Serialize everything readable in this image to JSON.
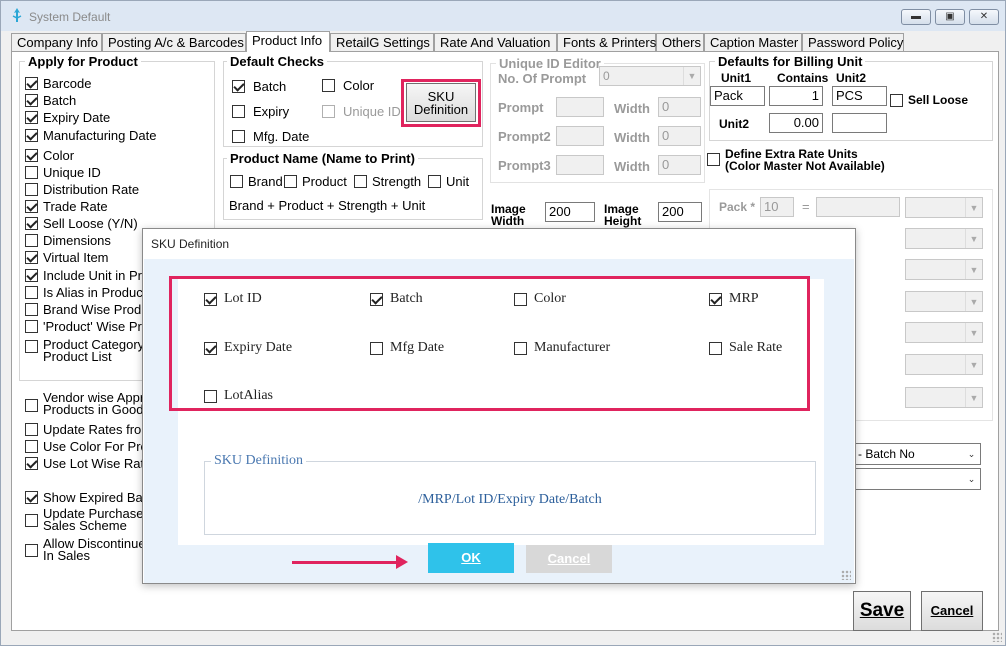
{
  "window": {
    "title": "System Default",
    "controls": {
      "minimize": "▬",
      "maximize": "▣",
      "close": "✕"
    }
  },
  "tabs": [
    "Company Info",
    "Posting A/c & Barcodes",
    "Product Info",
    "RetailG Settings",
    "Rate And Valuation",
    "Fonts & Printers",
    "Others",
    "Caption Master",
    "Password Policy"
  ],
  "apply_for_product": {
    "title": "Apply for Product",
    "items": [
      {
        "label": "Barcode",
        "checked": true
      },
      {
        "label": "Batch",
        "checked": true
      },
      {
        "label": "Expiry Date",
        "checked": true
      },
      {
        "label": "Manufacturing Date",
        "checked": true
      },
      {
        "label": "Color",
        "checked": true
      },
      {
        "label": "Unique ID",
        "checked": false
      },
      {
        "label": "Distribution Rate",
        "checked": false
      },
      {
        "label": "Trade Rate",
        "checked": true
      },
      {
        "label": "Sell Loose (Y/N)",
        "checked": true
      },
      {
        "label": "Dimensions",
        "checked": false
      },
      {
        "label": "Virtual Item",
        "checked": true
      },
      {
        "label": "Include Unit in Pr",
        "checked": true
      },
      {
        "label": "Is Alias in Product",
        "checked": false
      },
      {
        "label": "Brand Wise Produ",
        "checked": false
      },
      {
        "label": "'Product' Wise Pr",
        "checked": false
      },
      {
        "label": "Product Category\nProduct List",
        "checked": false
      }
    ]
  },
  "left_options": [
    {
      "label": "Vendor wise Appr\nProducts in Goods",
      "checked": false
    },
    {
      "label": "Update Rates from",
      "checked": false
    },
    {
      "label": "Use Color For Pro",
      "checked": false
    },
    {
      "label": "Use Lot Wise Rate",
      "checked": true
    },
    {
      "label": "Show Expired Bat",
      "checked": true
    },
    {
      "label": "Update Purchase\nSales Scheme",
      "checked": false
    },
    {
      "label": "Allow Discontinue\nIn Sales",
      "checked": false
    }
  ],
  "default_checks": {
    "title": "Default Checks",
    "batch": {
      "label": "Batch",
      "checked": true
    },
    "color": {
      "label": "Color",
      "checked": false
    },
    "expiry": {
      "label": "Expiry",
      "checked": false
    },
    "unique_id": {
      "label": "Unique ID",
      "checked": false
    },
    "mfg_date": {
      "label": "Mfg. Date",
      "checked": false
    },
    "sku_button": "SKU\nDefinition"
  },
  "product_name": {
    "title": "Product Name (Name to Print)",
    "options": [
      {
        "label": "Brand",
        "checked": false
      },
      {
        "label": "Product",
        "checked": false
      },
      {
        "label": "Strength",
        "checked": false
      },
      {
        "label": "Unit",
        "checked": false
      }
    ],
    "formula": "Brand + Product + Strength + Unit"
  },
  "unique_id_editor": {
    "title": "Unique ID Editor",
    "no_of_prompt_label": "No. Of Prompt",
    "no_of_prompt_value": "0",
    "prompts": [
      {
        "label": "Prompt",
        "width_label": "Width",
        "width": "0"
      },
      {
        "label": "Prompt2",
        "width_label": "Width",
        "width": "0"
      },
      {
        "label": "Prompt3",
        "width_label": "Width",
        "width": "0"
      }
    ]
  },
  "image": {
    "width_label": "Image\nWidth",
    "width": "200",
    "height_label": "Image\nHeight",
    "height": "200"
  },
  "billing_unit": {
    "title": "Defaults for Billing Unit",
    "unit1_label": "Unit1",
    "contains_label": "Contains",
    "unit2_label": "Unit2",
    "unit1": "Pack",
    "contains": "1",
    "unit2": "PCS",
    "sell_loose": {
      "label": "Sell Loose",
      "checked": false
    },
    "row2_label": "Unit2",
    "row2_value": "0.00",
    "row2_unit": ""
  },
  "extra_rate": {
    "label": "Define Extra Rate Units\n(Color Master Not Available)",
    "checked": false,
    "pack_label": "Pack *",
    "pack_value": "10",
    "equals": "="
  },
  "right_combos": {
    "batch_no": "- Batch No",
    "blank": ""
  },
  "actions": {
    "save": "Save",
    "cancel": "Cancel"
  },
  "sku_dialog": {
    "title": "SKU Definition",
    "options": [
      {
        "label": "Lot ID",
        "checked": true
      },
      {
        "label": "Batch",
        "checked": true
      },
      {
        "label": "Color",
        "checked": false
      },
      {
        "label": "MRP",
        "checked": true
      },
      {
        "label": "Expiry Date",
        "checked": true
      },
      {
        "label": "Mfg Date",
        "checked": false
      },
      {
        "label": "Manufacturer",
        "checked": false
      },
      {
        "label": "Sale Rate",
        "checked": false
      },
      {
        "label": "LotAlias",
        "checked": false
      }
    ],
    "definition_legend": "SKU Definition",
    "definition_value": "/MRP/Lot ID/Expiry Date/Batch",
    "ok": "OK",
    "cancel": "Cancel"
  },
  "colors": {
    "highlight": "#e0245e",
    "ok_button": "#2fc2ea",
    "link_blue": "#2c5f9b"
  }
}
